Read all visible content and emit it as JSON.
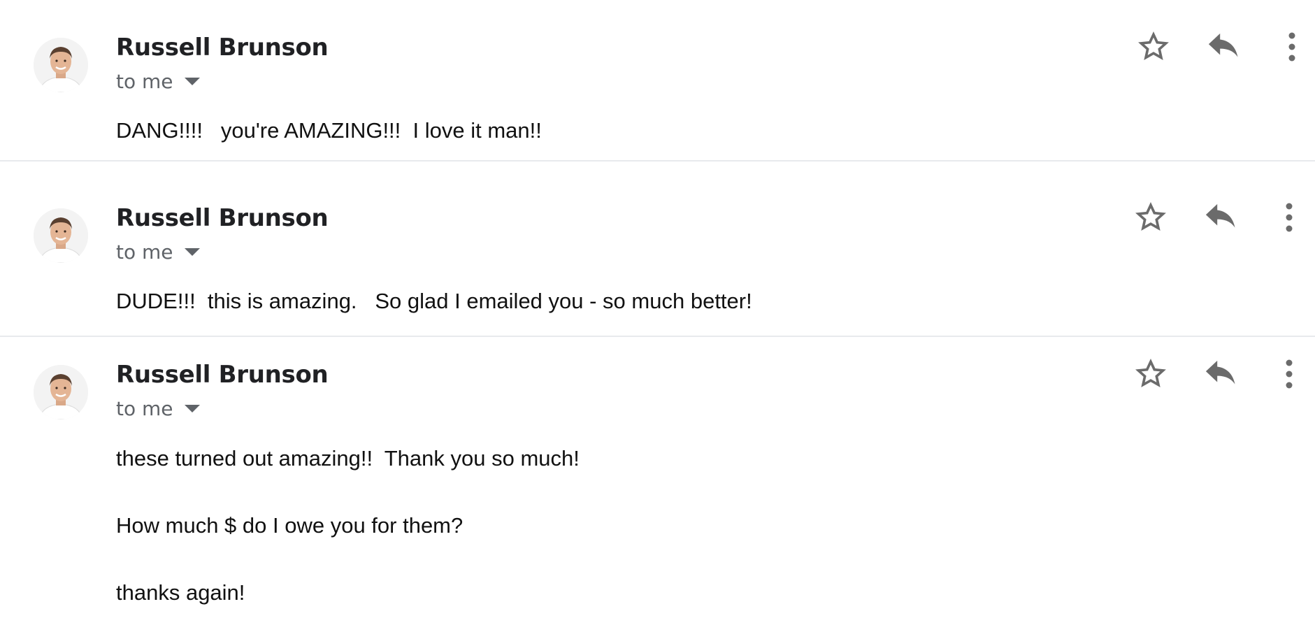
{
  "messages": [
    {
      "sender": "Russell Brunson",
      "recipient": "to me",
      "body_lines": [
        "DANG!!!!   you're AMAZING!!!  I love it man!!"
      ]
    },
    {
      "sender": "Russell Brunson",
      "recipient": "to me",
      "body_lines": [
        "DUDE!!!  this is amazing.   So glad I emailed you - so much better!"
      ]
    },
    {
      "sender": "Russell Brunson",
      "recipient": "to me",
      "body_lines": [
        "these turned out amazing!!  Thank you so much!",
        "How much $ do I owe you for them?",
        "thanks again!"
      ]
    }
  ],
  "icons": {
    "star": "star-outline-icon",
    "reply": "reply-icon",
    "more": "more-vertical-icon"
  },
  "colors": {
    "icon_gray": "#6b6b6b",
    "divider": "#e8eaed",
    "secondary_text": "#5f6368"
  }
}
